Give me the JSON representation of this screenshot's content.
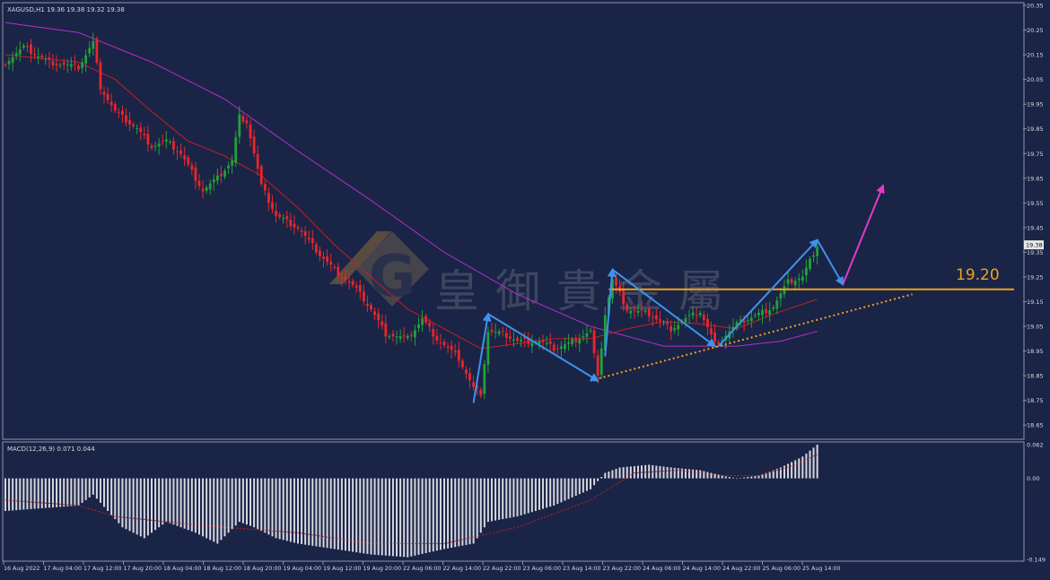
{
  "window": {
    "symbol_label": "XAGUSD,H1  19.36 19.38 19.32 19.38"
  },
  "watermark": {
    "brand_text": "皇御貴金屬",
    "logo_letter": "G"
  },
  "colors": {
    "background": "#1a2446",
    "grid": "#2a3560",
    "bull_candle": "#22a13a",
    "bear_candle": "#e8262b",
    "ma_slow": "#b62ec8",
    "ma_fast": "#c41f24",
    "level_line": "#f2a21a",
    "trend_dotted": "#f2a21a",
    "wave_arrow": "#3d93ee",
    "forecast_arrow": "#e23ac8",
    "macd_bar": "#d6d8e0",
    "macd_signal": "#c41f24",
    "text": "#d6d8e0"
  },
  "chart_data": {
    "type": "candlestick",
    "symbol": "XAGUSD",
    "timeframe": "H1",
    "price_axis": {
      "ylim": [
        18.6,
        20.35
      ],
      "ticks": [
        "20.35",
        "20.25",
        "20.15",
        "20.05",
        "19.95",
        "19.85",
        "19.75",
        "19.65",
        "19.55",
        "19.45",
        "19.35",
        "19.25",
        "19.15",
        "19.05",
        "18.95",
        "18.85",
        "18.75",
        "18.65"
      ],
      "current_price_label": "19.38",
      "current_price": 19.38
    },
    "time_axis": {
      "labels": [
        "16 Aug 2022",
        "17 Aug 04:00",
        "17 Aug 12:00",
        "17 Aug 20:00",
        "18 Aug 04:00",
        "18 Aug 12:00",
        "18 Aug 20:00",
        "19 Aug 04:00",
        "19 Aug 12:00",
        "19 Aug 20:00",
        "22 Aug 06:00",
        "22 Aug 14:00",
        "22 Aug 22:00",
        "23 Aug 06:00",
        "23 Aug 14:00",
        "23 Aug 22:00",
        "24 Aug 06:00",
        "24 Aug 14:00",
        "24 Aug 22:00",
        "25 Aug 06:00",
        "25 Aug 14:00"
      ]
    },
    "price_anchors": [
      [
        0,
        20.12
      ],
      [
        5,
        20.18
      ],
      [
        12,
        20.12
      ],
      [
        20,
        20.1
      ],
      [
        24,
        20.2
      ],
      [
        26,
        20.02
      ],
      [
        30,
        19.92
      ],
      [
        36,
        19.85
      ],
      [
        40,
        19.78
      ],
      [
        44,
        19.8
      ],
      [
        48,
        19.75
      ],
      [
        54,
        19.6
      ],
      [
        58,
        19.65
      ],
      [
        62,
        19.72
      ],
      [
        64,
        19.9
      ],
      [
        66,
        19.88
      ],
      [
        70,
        19.62
      ],
      [
        74,
        19.5
      ],
      [
        80,
        19.45
      ],
      [
        86,
        19.34
      ],
      [
        90,
        19.28
      ],
      [
        96,
        19.2
      ],
      [
        100,
        19.12
      ],
      [
        104,
        19.02
      ],
      [
        110,
        19.0
      ],
      [
        114,
        19.08
      ],
      [
        118,
        19.0
      ],
      [
        124,
        18.92
      ],
      [
        128,
        18.8
      ],
      [
        130,
        18.78
      ],
      [
        132,
        19.03
      ],
      [
        136,
        19.02
      ],
      [
        140,
        18.99
      ],
      [
        146,
        18.99
      ],
      [
        150,
        18.96
      ],
      [
        154,
        18.98
      ],
      [
        160,
        19.03
      ],
      [
        162,
        18.84
      ],
      [
        164,
        19.1
      ],
      [
        166,
        19.24
      ],
      [
        170,
        19.12
      ],
      [
        176,
        19.1
      ],
      [
        182,
        19.04
      ],
      [
        186,
        19.08
      ],
      [
        190,
        19.11
      ],
      [
        194,
        18.98
      ],
      [
        196,
        19.0
      ],
      [
        200,
        19.06
      ],
      [
        206,
        19.1
      ],
      [
        210,
        19.13
      ],
      [
        214,
        19.23
      ],
      [
        218,
        19.25
      ],
      [
        222,
        19.38
      ]
    ],
    "ma_fast": [
      [
        0,
        20.15
      ],
      [
        20,
        20.12
      ],
      [
        30,
        20.05
      ],
      [
        40,
        19.92
      ],
      [
        50,
        19.8
      ],
      [
        60,
        19.74
      ],
      [
        70,
        19.66
      ],
      [
        80,
        19.53
      ],
      [
        90,
        19.38
      ],
      [
        100,
        19.25
      ],
      [
        110,
        19.12
      ],
      [
        120,
        19.04
      ],
      [
        130,
        18.96
      ],
      [
        140,
        18.98
      ],
      [
        150,
        19.0
      ],
      [
        160,
        19.0
      ],
      [
        170,
        19.04
      ],
      [
        180,
        19.07
      ],
      [
        190,
        19.06
      ],
      [
        200,
        19.04
      ],
      [
        210,
        19.1
      ],
      [
        222,
        19.16
      ]
    ],
    "ma_slow": [
      [
        0,
        20.28
      ],
      [
        20,
        20.24
      ],
      [
        40,
        20.12
      ],
      [
        60,
        19.97
      ],
      [
        80,
        19.76
      ],
      [
        100,
        19.56
      ],
      [
        120,
        19.35
      ],
      [
        140,
        19.18
      ],
      [
        160,
        19.05
      ],
      [
        180,
        18.97
      ],
      [
        200,
        18.97
      ],
      [
        212,
        18.99
      ],
      [
        222,
        19.03
      ]
    ],
    "level_line": {
      "label": "19.20",
      "price": 19.2
    },
    "trendline_dotted": {
      "from": [
        160,
        18.83
      ],
      "to": [
        248,
        19.18
      ]
    },
    "wave_arrows": [
      [
        [
          128,
          18.74
        ],
        [
          132,
          19.1
        ],
        [
          162,
          18.83
        ]
      ],
      [
        [
          164,
          18.93
        ],
        [
          166,
          19.28
        ],
        [
          194,
          18.97
        ]
      ],
      [
        [
          195,
          18.97
        ],
        [
          222,
          19.4
        ],
        [
          229,
          19.22
        ]
      ]
    ],
    "forecast_arrow": {
      "from": [
        229,
        19.22
      ],
      "to": [
        240,
        19.62
      ]
    },
    "macd": {
      "label": "MACD(12,26,9) 0.071 0.044",
      "ticks": [
        "0.062",
        "0.00",
        "-0.149"
      ],
      "ylim": [
        -0.149,
        0.062
      ],
      "hist_anchors": [
        [
          0,
          -0.06
        ],
        [
          10,
          -0.055
        ],
        [
          20,
          -0.05
        ],
        [
          24,
          -0.03
        ],
        [
          28,
          -0.06
        ],
        [
          32,
          -0.09
        ],
        [
          38,
          -0.11
        ],
        [
          44,
          -0.08
        ],
        [
          52,
          -0.1
        ],
        [
          58,
          -0.12
        ],
        [
          64,
          -0.08
        ],
        [
          68,
          -0.09
        ],
        [
          74,
          -0.11
        ],
        [
          80,
          -0.12
        ],
        [
          90,
          -0.13
        ],
        [
          100,
          -0.14
        ],
        [
          110,
          -0.145
        ],
        [
          120,
          -0.13
        ],
        [
          128,
          -0.12
        ],
        [
          132,
          -0.08
        ],
        [
          140,
          -0.07
        ],
        [
          150,
          -0.05
        ],
        [
          160,
          -0.02
        ],
        [
          164,
          0.01
        ],
        [
          168,
          0.02
        ],
        [
          176,
          0.025
        ],
        [
          182,
          0.02
        ],
        [
          190,
          0.015
        ],
        [
          196,
          0.005
        ],
        [
          200,
          0.0
        ],
        [
          206,
          0.005
        ],
        [
          212,
          0.02
        ],
        [
          218,
          0.04
        ],
        [
          222,
          0.062
        ]
      ],
      "signal_anchors": [
        [
          0,
          -0.04
        ],
        [
          20,
          -0.05
        ],
        [
          30,
          -0.07
        ],
        [
          44,
          -0.08
        ],
        [
          60,
          -0.09
        ],
        [
          80,
          -0.1
        ],
        [
          100,
          -0.12
        ],
        [
          120,
          -0.12
        ],
        [
          140,
          -0.09
        ],
        [
          160,
          -0.04
        ],
        [
          172,
          0.01
        ],
        [
          184,
          0.015
        ],
        [
          196,
          0.005
        ],
        [
          206,
          0.005
        ],
        [
          216,
          0.025
        ],
        [
          222,
          0.044
        ]
      ]
    }
  }
}
